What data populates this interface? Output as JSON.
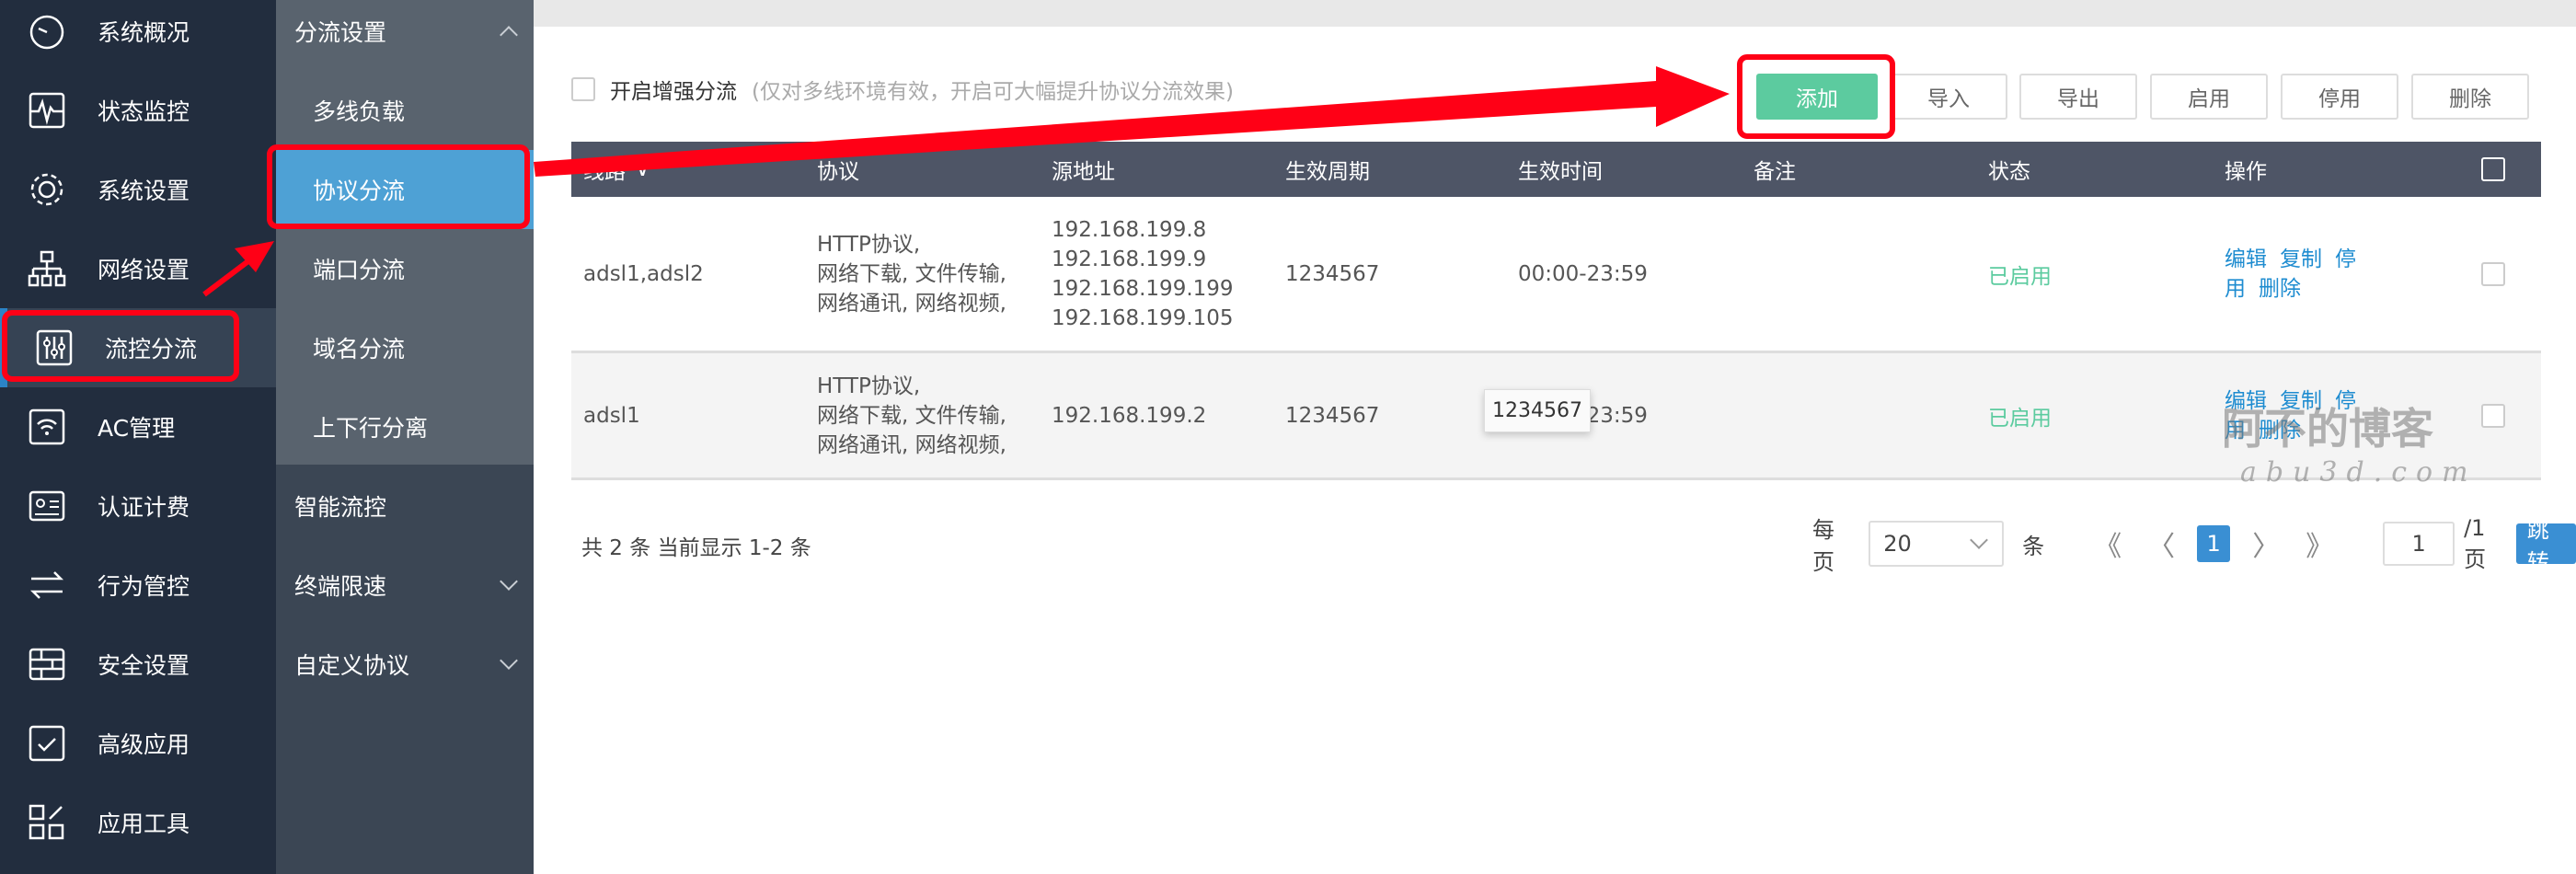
{
  "sidebar": {
    "items": [
      {
        "label": "系统概况",
        "icon": "speedometer-icon"
      },
      {
        "label": "状态监控",
        "icon": "pulse-monitor-icon"
      },
      {
        "label": "系统设置",
        "icon": "gear-icon"
      },
      {
        "label": "网络设置",
        "icon": "network-icon"
      },
      {
        "label": "流控分流",
        "icon": "sliders-icon",
        "active": true
      },
      {
        "label": "AC管理",
        "icon": "wifi-icon"
      },
      {
        "label": "认证计费",
        "icon": "id-card-icon"
      },
      {
        "label": "行为管控",
        "icon": "arrows-exchange-icon"
      },
      {
        "label": "安全设置",
        "icon": "firewall-icon"
      },
      {
        "label": "高级应用",
        "icon": "checklist-icon"
      },
      {
        "label": "应用工具",
        "icon": "tools-icon"
      }
    ]
  },
  "submenu": {
    "group": "分流设置",
    "children": [
      "多线负载",
      "协议分流",
      "端口分流",
      "域名分流",
      "上下行分离"
    ],
    "active": "协议分流",
    "others": [
      "智能流控",
      "终端限速",
      "自定义协议"
    ]
  },
  "toolbar": {
    "enhance_label": "开启增强分流",
    "enhance_hint": "(仅对多线环境有效，开启可大幅提升协议分流效果)",
    "buttons": {
      "add": "添加",
      "import": "导入",
      "export": "导出",
      "enable": "启用",
      "disable": "停用",
      "delete": "删除"
    }
  },
  "table": {
    "headers": [
      "线路",
      "协议",
      "源地址",
      "生效周期",
      "生效时间",
      "备注",
      "状态",
      "操作"
    ],
    "rows": [
      {
        "line": "adsl1,adsl2",
        "protocol": [
          "HTTP协议,",
          "网络下载, 文件传输,",
          "网络通讯, 网络视频,"
        ],
        "source": [
          "192.168.199.8",
          "192.168.199.9",
          "192.168.199.199",
          "192.168.199.105"
        ],
        "period": "1234567",
        "time": "00:00-23:59",
        "note": "",
        "status": "已启用",
        "ops": [
          "编辑",
          "复制",
          "停用",
          "删除"
        ]
      },
      {
        "line": "adsl1",
        "protocol": [
          "HTTP协议,",
          "网络下载, 文件传输,",
          "网络通讯, 网络视频,"
        ],
        "source": [
          "192.168.199.2"
        ],
        "period": "1234567",
        "time": "00:00-23:59",
        "note": "",
        "status": "已启用",
        "ops": [
          "编辑",
          "复制",
          "停用",
          "删除"
        ]
      }
    ],
    "tooltip": "1234567"
  },
  "footer": {
    "count": "共 2 条 当前显示 1-2 条",
    "per_page_label": "每页",
    "per_page": "20",
    "unit": "条",
    "current_page": "1",
    "jump_value": "1",
    "total_pages": "/1页",
    "jump": "跳转"
  },
  "colors": {
    "sidebar": "#222d3e",
    "submenu": "#59636e",
    "active": "#4ea1d5",
    "primary": "#5ccb9f",
    "header": "#4e5566",
    "link": "#1e8cd0",
    "annotation": "#ff0016"
  },
  "watermark": {
    "cn": "阿不的博客",
    "en": "abu3d.com"
  }
}
